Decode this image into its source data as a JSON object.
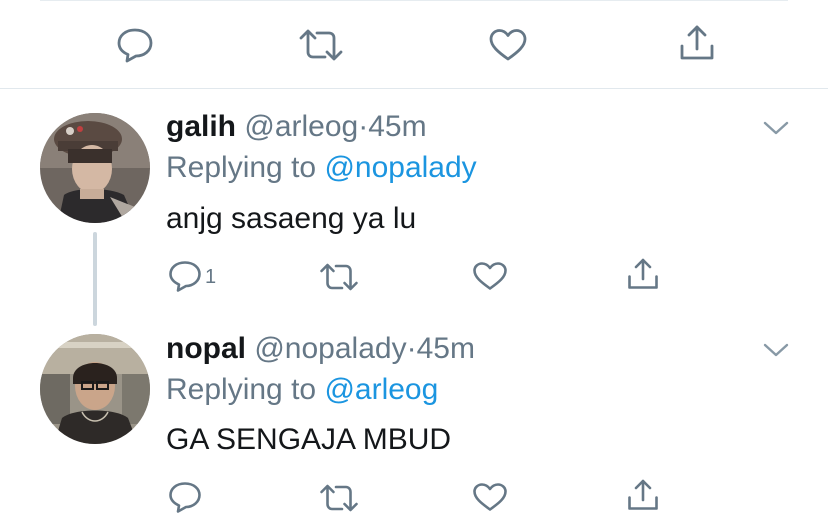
{
  "colors": {
    "text_primary": "#14171a",
    "text_secondary": "#657786",
    "link": "#1b95e0",
    "divider": "#e1e8ed",
    "thread_line": "#ccd6dd"
  },
  "top_action_bar": {
    "icons": [
      "reply-icon",
      "retweet-icon",
      "like-icon",
      "share-icon"
    ]
  },
  "tweets": [
    {
      "display_name": "galih",
      "handle": "@arleog",
      "separator": "·",
      "time": "45m",
      "replying_prefix": "Replying to",
      "replying_to": "@nopalady",
      "text": "anjg sasaeng ya lu",
      "reply_count": "1",
      "avatar": "avatar-photo"
    },
    {
      "display_name": "nopal",
      "handle": "@nopalady",
      "separator": "·",
      "time": "45m",
      "replying_prefix": "Replying to",
      "replying_to": "@arleog",
      "text": "GA SENGAJA MBUD",
      "reply_count": "",
      "avatar": "avatar-photo"
    }
  ]
}
